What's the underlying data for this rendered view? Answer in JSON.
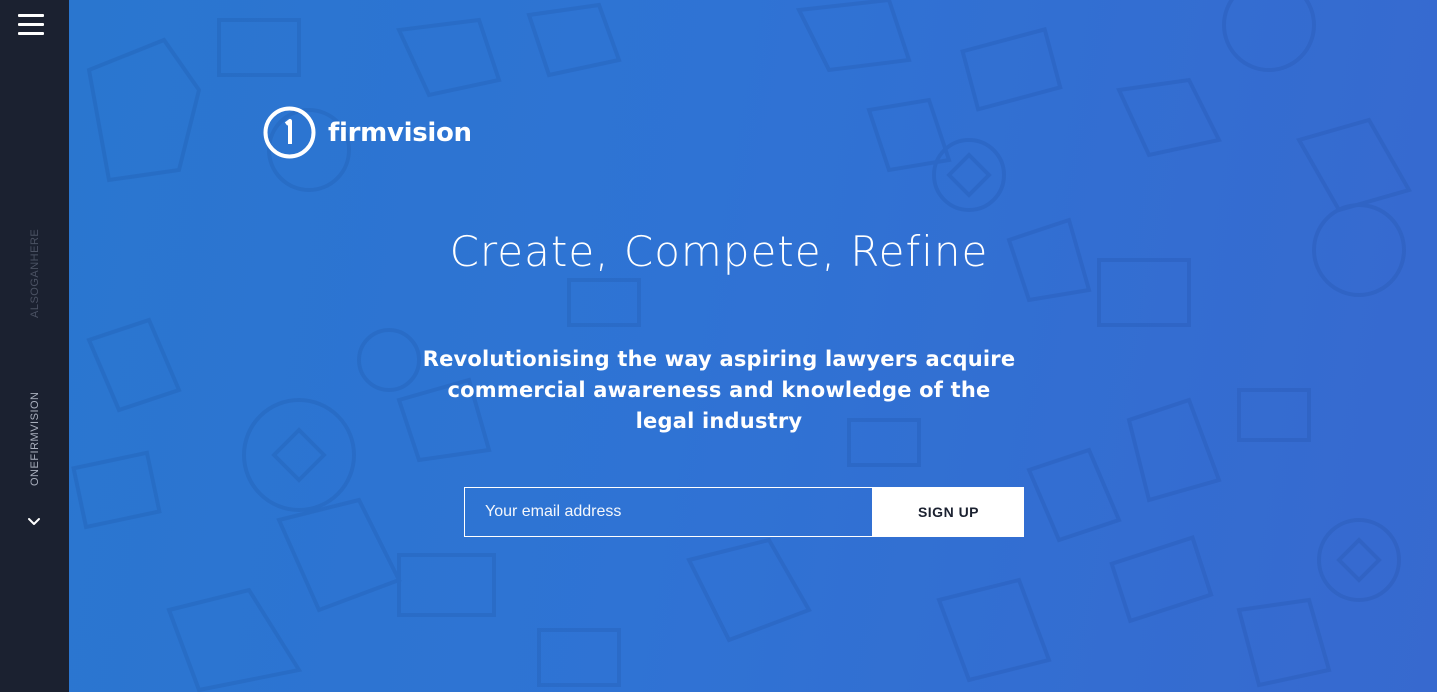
{
  "sidebar": {
    "slogan": "ALSOGANHERE",
    "brand": "ONEFIRMVISION"
  },
  "logo": {
    "mark_text": "1",
    "name": "firmvision"
  },
  "hero": {
    "headline": "Create, Compete, Refine",
    "subheadline": "Revolutionising the way aspiring lawyers acquire commercial awareness and knowledge of the legal industry"
  },
  "signup": {
    "email_placeholder": "Your email address",
    "email_value": "",
    "button_label": "SIGN UP"
  },
  "colors": {
    "sidebar_bg": "#1b2130",
    "hero_bg_start": "#2a76cf",
    "hero_bg_end": "#3769cf",
    "text": "#ffffff"
  },
  "icons": [
    "menu-icon",
    "chevron-down-icon",
    "logo-icon"
  ]
}
